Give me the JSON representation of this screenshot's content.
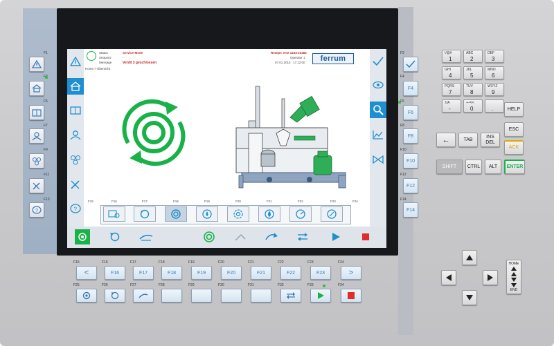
{
  "header": {
    "status_label": "Status",
    "status_value": "Service-Mode",
    "sequence_label": "Sequenz",
    "sequence_value": "-",
    "message_label": "Message",
    "message_value": "Ventil 3 geschlossen",
    "recipe": "Rezept: XYZ-1234-23482",
    "operator": "Operator 1",
    "date": "07.01.2015",
    "time": "17:12:00",
    "logo": "ferrum"
  },
  "breadcrumb": "Home > Übersicht",
  "screen_fkeys": [
    "F15",
    "F16",
    "F17",
    "F18",
    "F19",
    "F20",
    "F21",
    "F22",
    "F23",
    "F24"
  ],
  "left_side_keys": [
    "F1",
    "F2",
    "F3",
    "F4",
    "F5",
    "F6",
    "F7",
    "F8",
    "F9",
    "F10",
    "F11",
    "F12",
    "F13",
    "F14"
  ],
  "right_side_keys": [
    {
      "fn": "F2",
      "label": ""
    },
    {
      "fn": "F4",
      "label": "F4"
    },
    {
      "fn": "F6",
      "label": "F6"
    },
    {
      "fn": "F8",
      "label": "F8"
    },
    {
      "fn": "F10",
      "label": "F10"
    },
    {
      "fn": "F12",
      "label": "F12"
    },
    {
      "fn": "F14",
      "label": "F14"
    }
  ],
  "bottom_row1": [
    {
      "fn": "F15",
      "label": "<"
    },
    {
      "fn": "F16",
      "label": "F16"
    },
    {
      "fn": "F17",
      "label": "F17"
    },
    {
      "fn": "F18",
      "label": "F18"
    },
    {
      "fn": "F19",
      "label": "F19"
    },
    {
      "fn": "F20",
      "label": "F20"
    },
    {
      "fn": "F21",
      "label": "F21"
    },
    {
      "fn": "F22",
      "label": "F22"
    },
    {
      "fn": "F23",
      "label": "F23"
    },
    {
      "fn": "F24",
      "label": ">"
    }
  ],
  "bottom_row2_labels": [
    "F25",
    "F26",
    "F27",
    "F28",
    "F29",
    "F30",
    "F31",
    "F32",
    "F33",
    "F34"
  ],
  "numpad": [
    {
      "sm": "!/@#",
      "big": "1"
    },
    {
      "sm": "ABC",
      "big": "2"
    },
    {
      "sm": "DEF",
      "big": "3"
    },
    {
      "sm": "GHI",
      "big": "4"
    },
    {
      "sm": "JKL",
      "big": "5"
    },
    {
      "sm": "MNO",
      "big": "6"
    },
    {
      "sm": "PQRS",
      "big": "7"
    },
    {
      "sm": "TUV",
      "big": "8"
    },
    {
      "sm": "WXYZ",
      "big": "9"
    },
    {
      "sm": "±/A",
      "big": "-"
    },
    {
      "sm": "+-=/<",
      "big": "0"
    },
    {
      "sm": "",
      "big": "."
    }
  ],
  "control_keys": {
    "help": "HELP",
    "esc": "ESC",
    "backspace": "←",
    "tab": "TAB",
    "ins": "INS",
    "del": "DEL",
    "ack": "ACK",
    "shift": "SHIFT",
    "ctrl": "CTRL",
    "alt": "ALT",
    "enter": "ENTER",
    "home": "HOME",
    "end": "END"
  },
  "colors": {
    "accent_blue": "#1f8fcf",
    "green": "#19b248",
    "screen_bg": "#ffffff",
    "panel": "#cdcdd0"
  }
}
